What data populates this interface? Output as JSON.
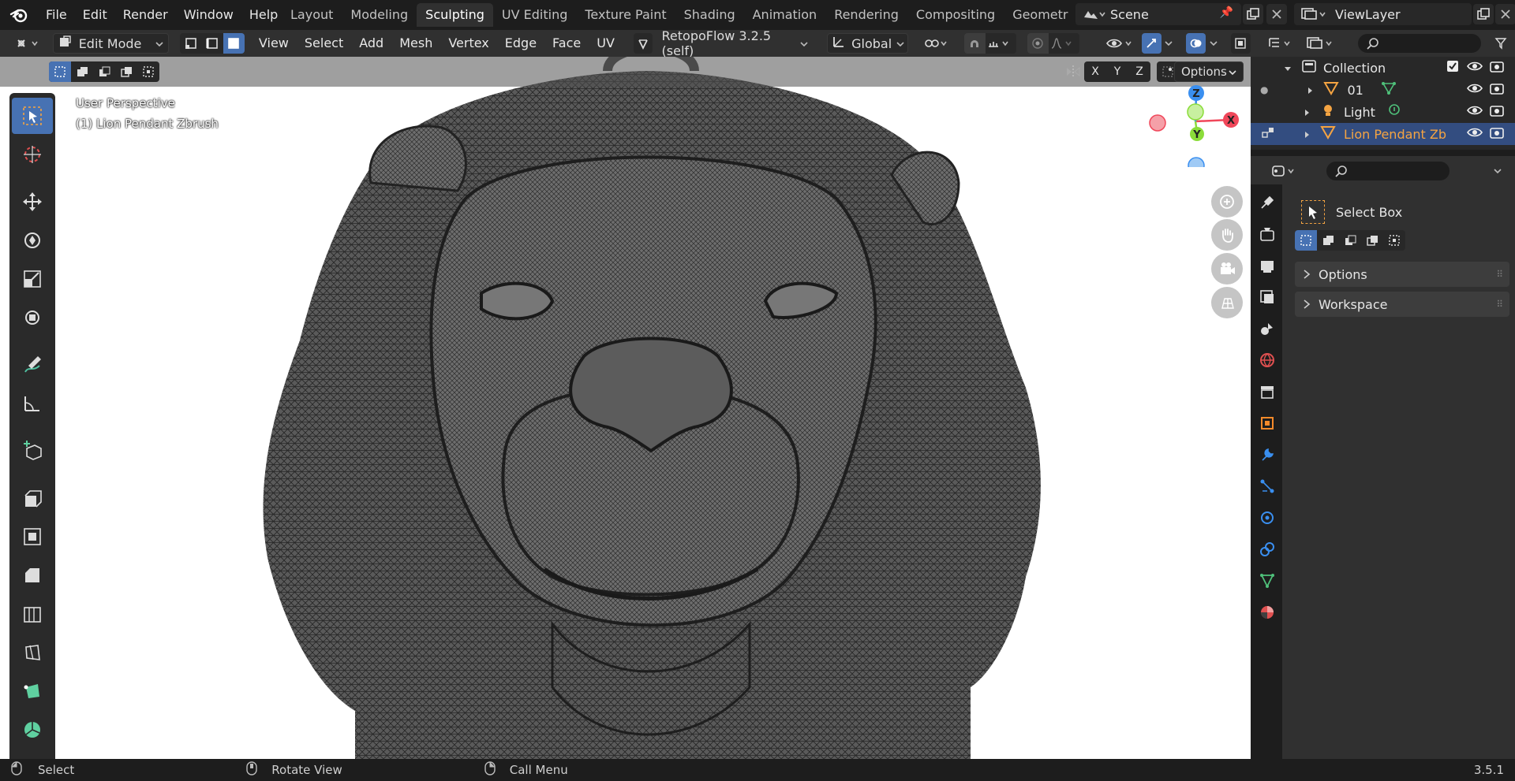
{
  "menus": [
    "File",
    "Edit",
    "Render",
    "Window",
    "Help"
  ],
  "workspace_tabs": [
    "Layout",
    "Modeling",
    "Sculpting",
    "UV Editing",
    "Texture Paint",
    "Shading",
    "Animation",
    "Rendering",
    "Compositing",
    "Geometry Noc"
  ],
  "active_tab": "Sculpting",
  "scene": {
    "label": "Scene"
  },
  "view_layer": {
    "label": "ViewLayer"
  },
  "header": {
    "mode": "Edit Mode",
    "menus": [
      "View",
      "Select",
      "Add",
      "Mesh",
      "Vertex",
      "Edge",
      "Face",
      "UV"
    ],
    "addon": "RetopoFlow 3.2.5 (self)",
    "orientation": "Global"
  },
  "viewport": {
    "overlay_line1": "User Perspective",
    "overlay_line2": "(1) Lion Pendant Zbrush",
    "axis_x": "X",
    "axis_y": "Y",
    "axis_z": "Z",
    "options_label": "Options",
    "mirror_x": "X",
    "mirror_y": "Y",
    "mirror_z": "Z"
  },
  "outliner": {
    "collection": "Collection",
    "items": [
      {
        "name": "01",
        "icon": "mesh-icon"
      },
      {
        "name": "Light",
        "icon": "light-icon"
      },
      {
        "name": "Lion Pendant Zb",
        "icon": "mesh-icon",
        "selected": true
      }
    ]
  },
  "properties": {
    "tool_name": "Select Box",
    "panels": [
      "Options",
      "Workspace"
    ]
  },
  "status": {
    "select": "Select",
    "rotate": "Rotate View",
    "call_menu": "Call Menu",
    "version": "3.5.1"
  },
  "colors": {
    "accent": "#4772b3",
    "selected_text": "#f5a442",
    "x_axis": "#f0475a",
    "y_axis": "#8bdc3a",
    "z_axis": "#3a8ff0"
  }
}
